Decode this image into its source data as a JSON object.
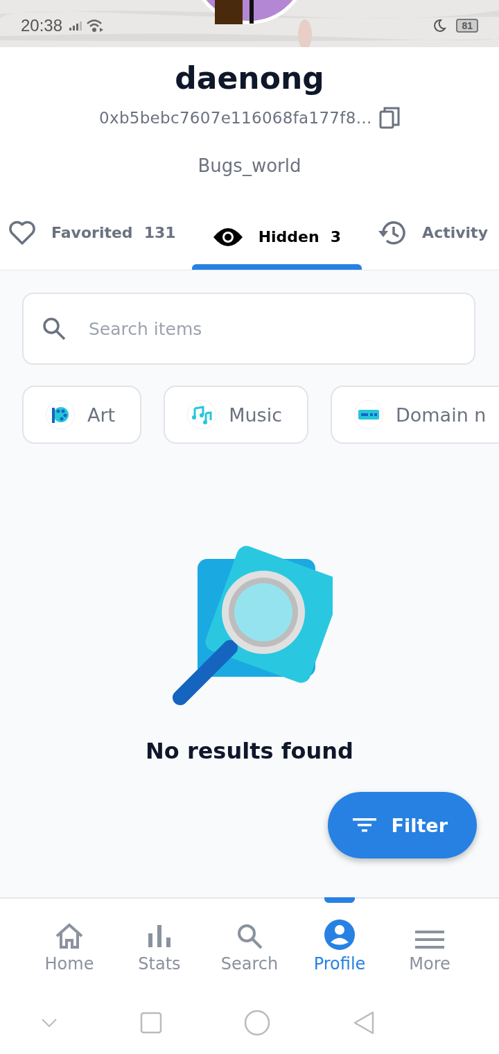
{
  "status_bar": {
    "time": "20:38",
    "battery": "81"
  },
  "profile": {
    "name": "daenong",
    "address": "0xb5bebc7607e116068fa177f8…",
    "collection": "Bugs_world"
  },
  "tabs": [
    {
      "label": "Favorited",
      "count": "131",
      "selected": false
    },
    {
      "label": "Hidden",
      "count": "3",
      "selected": true
    },
    {
      "label": "Activity",
      "selected": false
    }
  ],
  "search": {
    "placeholder": "Search items"
  },
  "categories": [
    {
      "label": "Art"
    },
    {
      "label": "Music"
    },
    {
      "label": "Domain n"
    }
  ],
  "empty_state": {
    "message": "No results found"
  },
  "filter_button": {
    "label": "Filter"
  },
  "bottom_nav": [
    {
      "label": "Home",
      "selected": false
    },
    {
      "label": "Stats",
      "selected": false
    },
    {
      "label": "Search",
      "selected": false
    },
    {
      "label": "Profile",
      "selected": true
    },
    {
      "label": "More",
      "selected": false
    }
  ]
}
